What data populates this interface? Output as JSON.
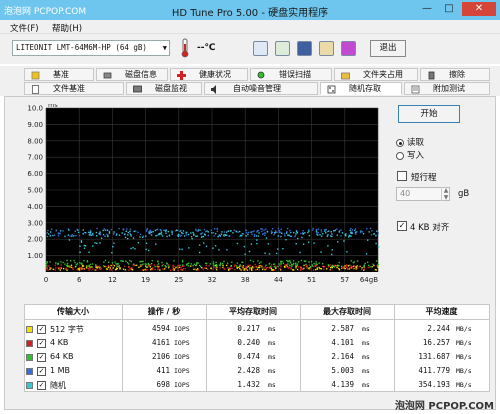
{
  "watermark_top": "泡泡网 PCPOP.COM",
  "window": {
    "title": "HD Tune Pro 5.00 - 硬盘实用程序",
    "min": "—",
    "max": "□",
    "close": "✕"
  },
  "menu": {
    "file": "文件(F)",
    "help": "帮助(H)"
  },
  "toolbar": {
    "drive": "LITEONIT LMT-64M6M-HP (64 gB)",
    "temperature": "--℃",
    "exit_label": "退出",
    "icons": [
      "copy-info-icon",
      "copy-screen-icon",
      "save-icon",
      "options-icon",
      "download-icon"
    ]
  },
  "tabs_row1": [
    {
      "label": "基准",
      "icon": "benchmark-icon"
    },
    {
      "label": "磁盘信息",
      "icon": "disk-info-icon"
    },
    {
      "label": "健康状况",
      "icon": "health-icon"
    },
    {
      "label": "错误扫描",
      "icon": "error-scan-icon"
    },
    {
      "label": "文件夹占用",
      "icon": "folder-usage-icon"
    },
    {
      "label": "擦除",
      "icon": "erase-icon"
    }
  ],
  "tabs_row2": [
    {
      "label": "文件基准",
      "icon": "file-benchmark-icon"
    },
    {
      "label": "磁盘监视",
      "icon": "disk-monitor-icon"
    },
    {
      "label": "自动噪音管理",
      "icon": "aam-icon"
    },
    {
      "label": "随机存取",
      "icon": "random-access-icon",
      "active": true
    },
    {
      "label": "附加测试",
      "icon": "extra-tests-icon"
    }
  ],
  "controls": {
    "start_label": "开始",
    "read_label": "读取",
    "write_label": "写入",
    "read_selected": true,
    "short_stroke_label": "短行程",
    "short_stroke_checked": false,
    "short_stroke_value": "40",
    "gb_unit": "gB",
    "align_label": "4 KB 对齐",
    "align_checked": true,
    "check_mark": "✓"
  },
  "chart_data": {
    "type": "scatter",
    "xlabel": "",
    "ylabel": "ms",
    "x_unit": "gB",
    "xlim": [
      0,
      64
    ],
    "ylim": [
      0,
      10
    ],
    "x_ticks": [
      "0",
      "6",
      "12",
      "19",
      "25",
      "32",
      "38",
      "44",
      "51",
      "57",
      "64gB"
    ],
    "y_ticks": [
      "10.0",
      "9.00",
      "8.00",
      "7.00",
      "6.00",
      "5.00",
      "4.00",
      "3.00",
      "2.00",
      "1.00"
    ],
    "grid": true,
    "series": [
      {
        "name": "512 字节",
        "color": "#f2e000",
        "band": [
          0.15,
          0.45
        ]
      },
      {
        "name": "4 KB",
        "color": "#d42020",
        "band": [
          0.15,
          0.5
        ]
      },
      {
        "name": "64 KB",
        "color": "#2ec02e",
        "band": [
          0.35,
          0.75
        ]
      },
      {
        "name": "1 MB",
        "color": "#2e6fd8",
        "band": [
          2.2,
          2.7
        ]
      },
      {
        "name": "随机",
        "color": "#36c8d8",
        "band": [
          1.1,
          2.6
        ]
      }
    ]
  },
  "table": {
    "headers": [
      "传输大小",
      "操作 / 秒",
      "平均存取时间",
      "最大存取时间",
      "平均速度"
    ],
    "rows": [
      {
        "size": "512 字节",
        "color": "#f2e000",
        "iops": "4594",
        "avg": "0.217",
        "max": "2.587",
        "speed": "2.244"
      },
      {
        "size": "4 KB",
        "color": "#d42020",
        "iops": "4161",
        "avg": "0.240",
        "max": "4.101",
        "speed": "16.257"
      },
      {
        "size": "64 KB",
        "color": "#2ec02e",
        "iops": "2106",
        "avg": "0.474",
        "max": "2.164",
        "speed": "131.687"
      },
      {
        "size": "1 MB",
        "color": "#2e6fd8",
        "iops": "411",
        "avg": "2.428",
        "max": "5.003",
        "speed": "411.779"
      },
      {
        "size": "随机",
        "color": "#36c8d8",
        "iops": "698",
        "avg": "1.432",
        "max": "4.139",
        "speed": "354.193"
      }
    ],
    "unit_iops": "IOPS",
    "unit_ms": "ms",
    "unit_speed": "MB/s"
  },
  "watermark_bottom": "泡泡网 PCPOP.COM"
}
